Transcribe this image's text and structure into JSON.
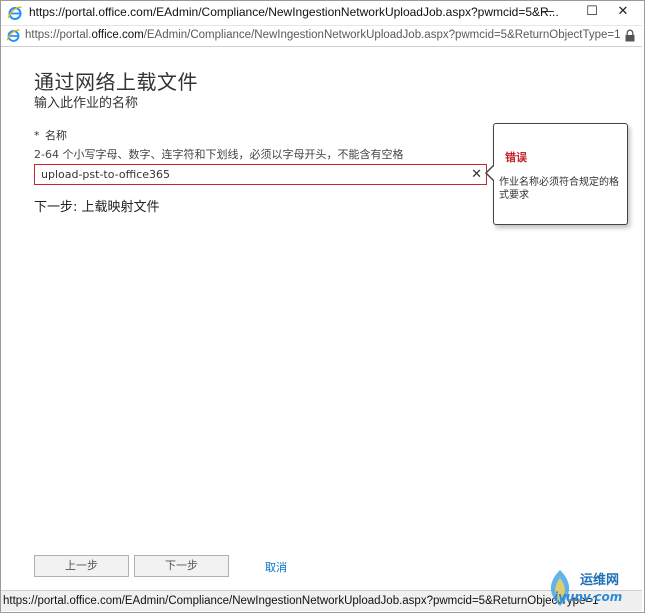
{
  "window": {
    "title": "https://portal.office.com/EAdmin/Compliance/NewIngestionNetworkUploadJob.aspx?pwmcid=5&R...",
    "minimize": "—",
    "maximize": "☐",
    "close": "✕"
  },
  "address_bar": {
    "url_prefix": "https://portal.",
    "url_domain": "office.com",
    "url_path": "/EAdmin/Compliance/NewIngestionNetworkUploadJob.aspx?pwmcid=5&ReturnObjectType=1"
  },
  "form": {
    "heading": "通过网络上载文件",
    "subheading": "输入此作业的名称",
    "name_label_required": "*",
    "name_label": "名称",
    "name_hint": "2-64 个小写字母、数字、连字符和下划线，必须以字母开头，不能含有空格",
    "name_value": "upload-pst-to-office365",
    "clear_glyph": "✕",
    "next_step_link": "下一步: 上载映射文件"
  },
  "error": {
    "title": "错误",
    "message": "作业名称必须符合规定的格式要求"
  },
  "buttons": {
    "back": "上一步",
    "next": "下一步",
    "cancel": "取消"
  },
  "status_bar": {
    "text": "https://portal.office.com/EAdmin/Compliance/NewIngestionNetworkUploadJob.aspx?pwmcid=5&ReturnObjectType=1"
  },
  "watermark": {
    "text": "运维网",
    "subtext": "iyunv.com"
  },
  "colors": {
    "error_red": "#c4262e",
    "link_blue": "#0072c6",
    "ie_blue": "#1e90ff"
  }
}
